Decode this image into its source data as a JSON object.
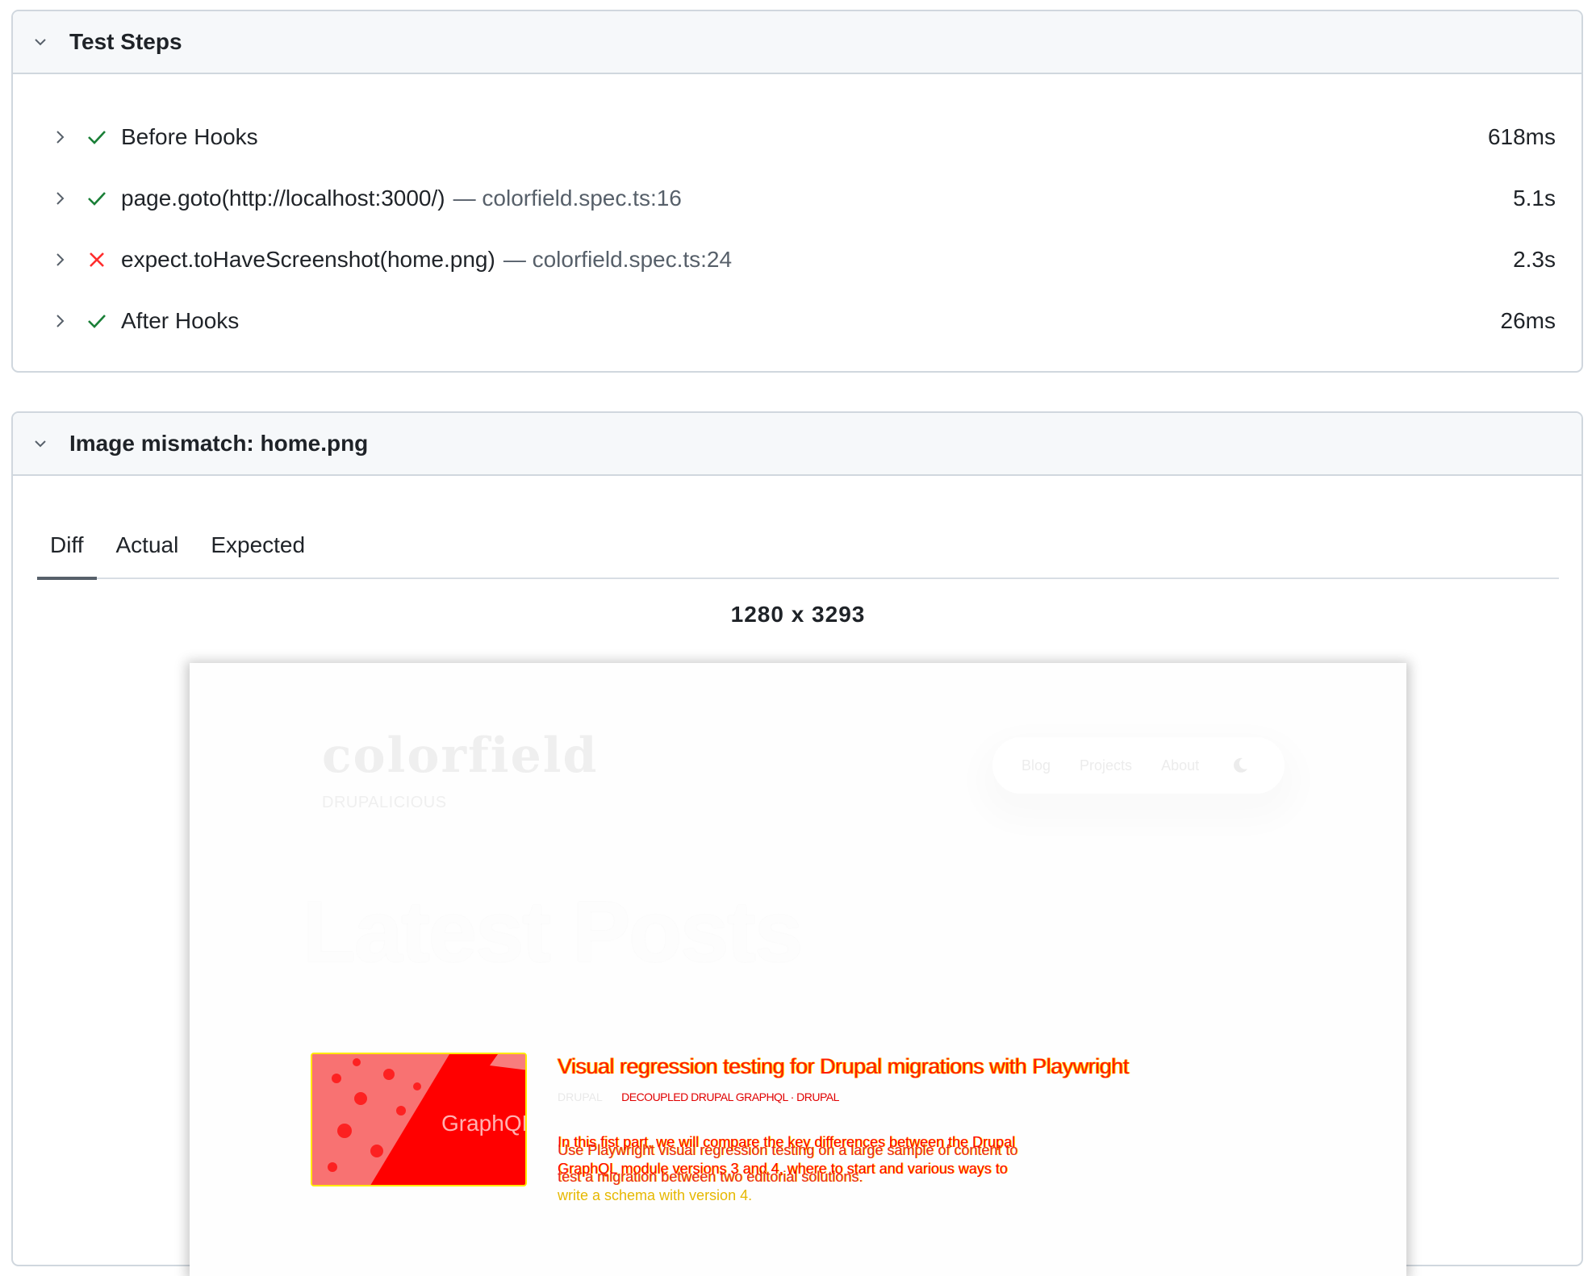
{
  "test_steps": {
    "title": "Test Steps",
    "steps": [
      {
        "title": "Before Hooks",
        "location": "",
        "duration": "618ms",
        "status": "passed"
      },
      {
        "title": "page.goto(http://localhost:3000/)",
        "location": "— colorfield.spec.ts:16",
        "duration": "5.1s",
        "status": "passed"
      },
      {
        "title": "expect.toHaveScreenshot(home.png)",
        "location": "— colorfield.spec.ts:24",
        "duration": "2.3s",
        "status": "failed"
      },
      {
        "title": "After Hooks",
        "location": "",
        "duration": "26ms",
        "status": "passed"
      }
    ]
  },
  "image_mismatch": {
    "title": "Image mismatch: home.png",
    "tabs": [
      {
        "label": "Diff",
        "active": true
      },
      {
        "label": "Actual",
        "active": false
      },
      {
        "label": "Expected",
        "active": false
      }
    ],
    "image_size": "1280 x 3293",
    "preview": {
      "logo": "colorfield",
      "tagline": "DRUPALICIOUS",
      "nav": [
        "Blog",
        "Projects",
        "About"
      ],
      "heading": "Latest Posts",
      "post": {
        "title": "Visual regression testing for Drupal migrations with Playwright",
        "meta_category": "DRUPAL",
        "meta_diff": "DECOUPLED DRUPAL GRAPHQL · DRUPAL",
        "body_expected": "In this fist part, we will compare the key differences between the Drupal GraphQL module versions 3 and 4, where to start and various ways to",
        "body_tail": "write a schema with version 4.",
        "body_actual": "Use Playwright visual regression testing on a large sample of content to test a migration between two editorial solutions."
      },
      "thumbnail_text": "GraphQL"
    }
  },
  "colors": {
    "passed": "#1a7f37",
    "failed": "#ff2d2d",
    "diff_red": "#ff0000",
    "diff_yellow": "#ffe800",
    "border": "#d0d7de",
    "header_bg": "#f6f8fa"
  }
}
